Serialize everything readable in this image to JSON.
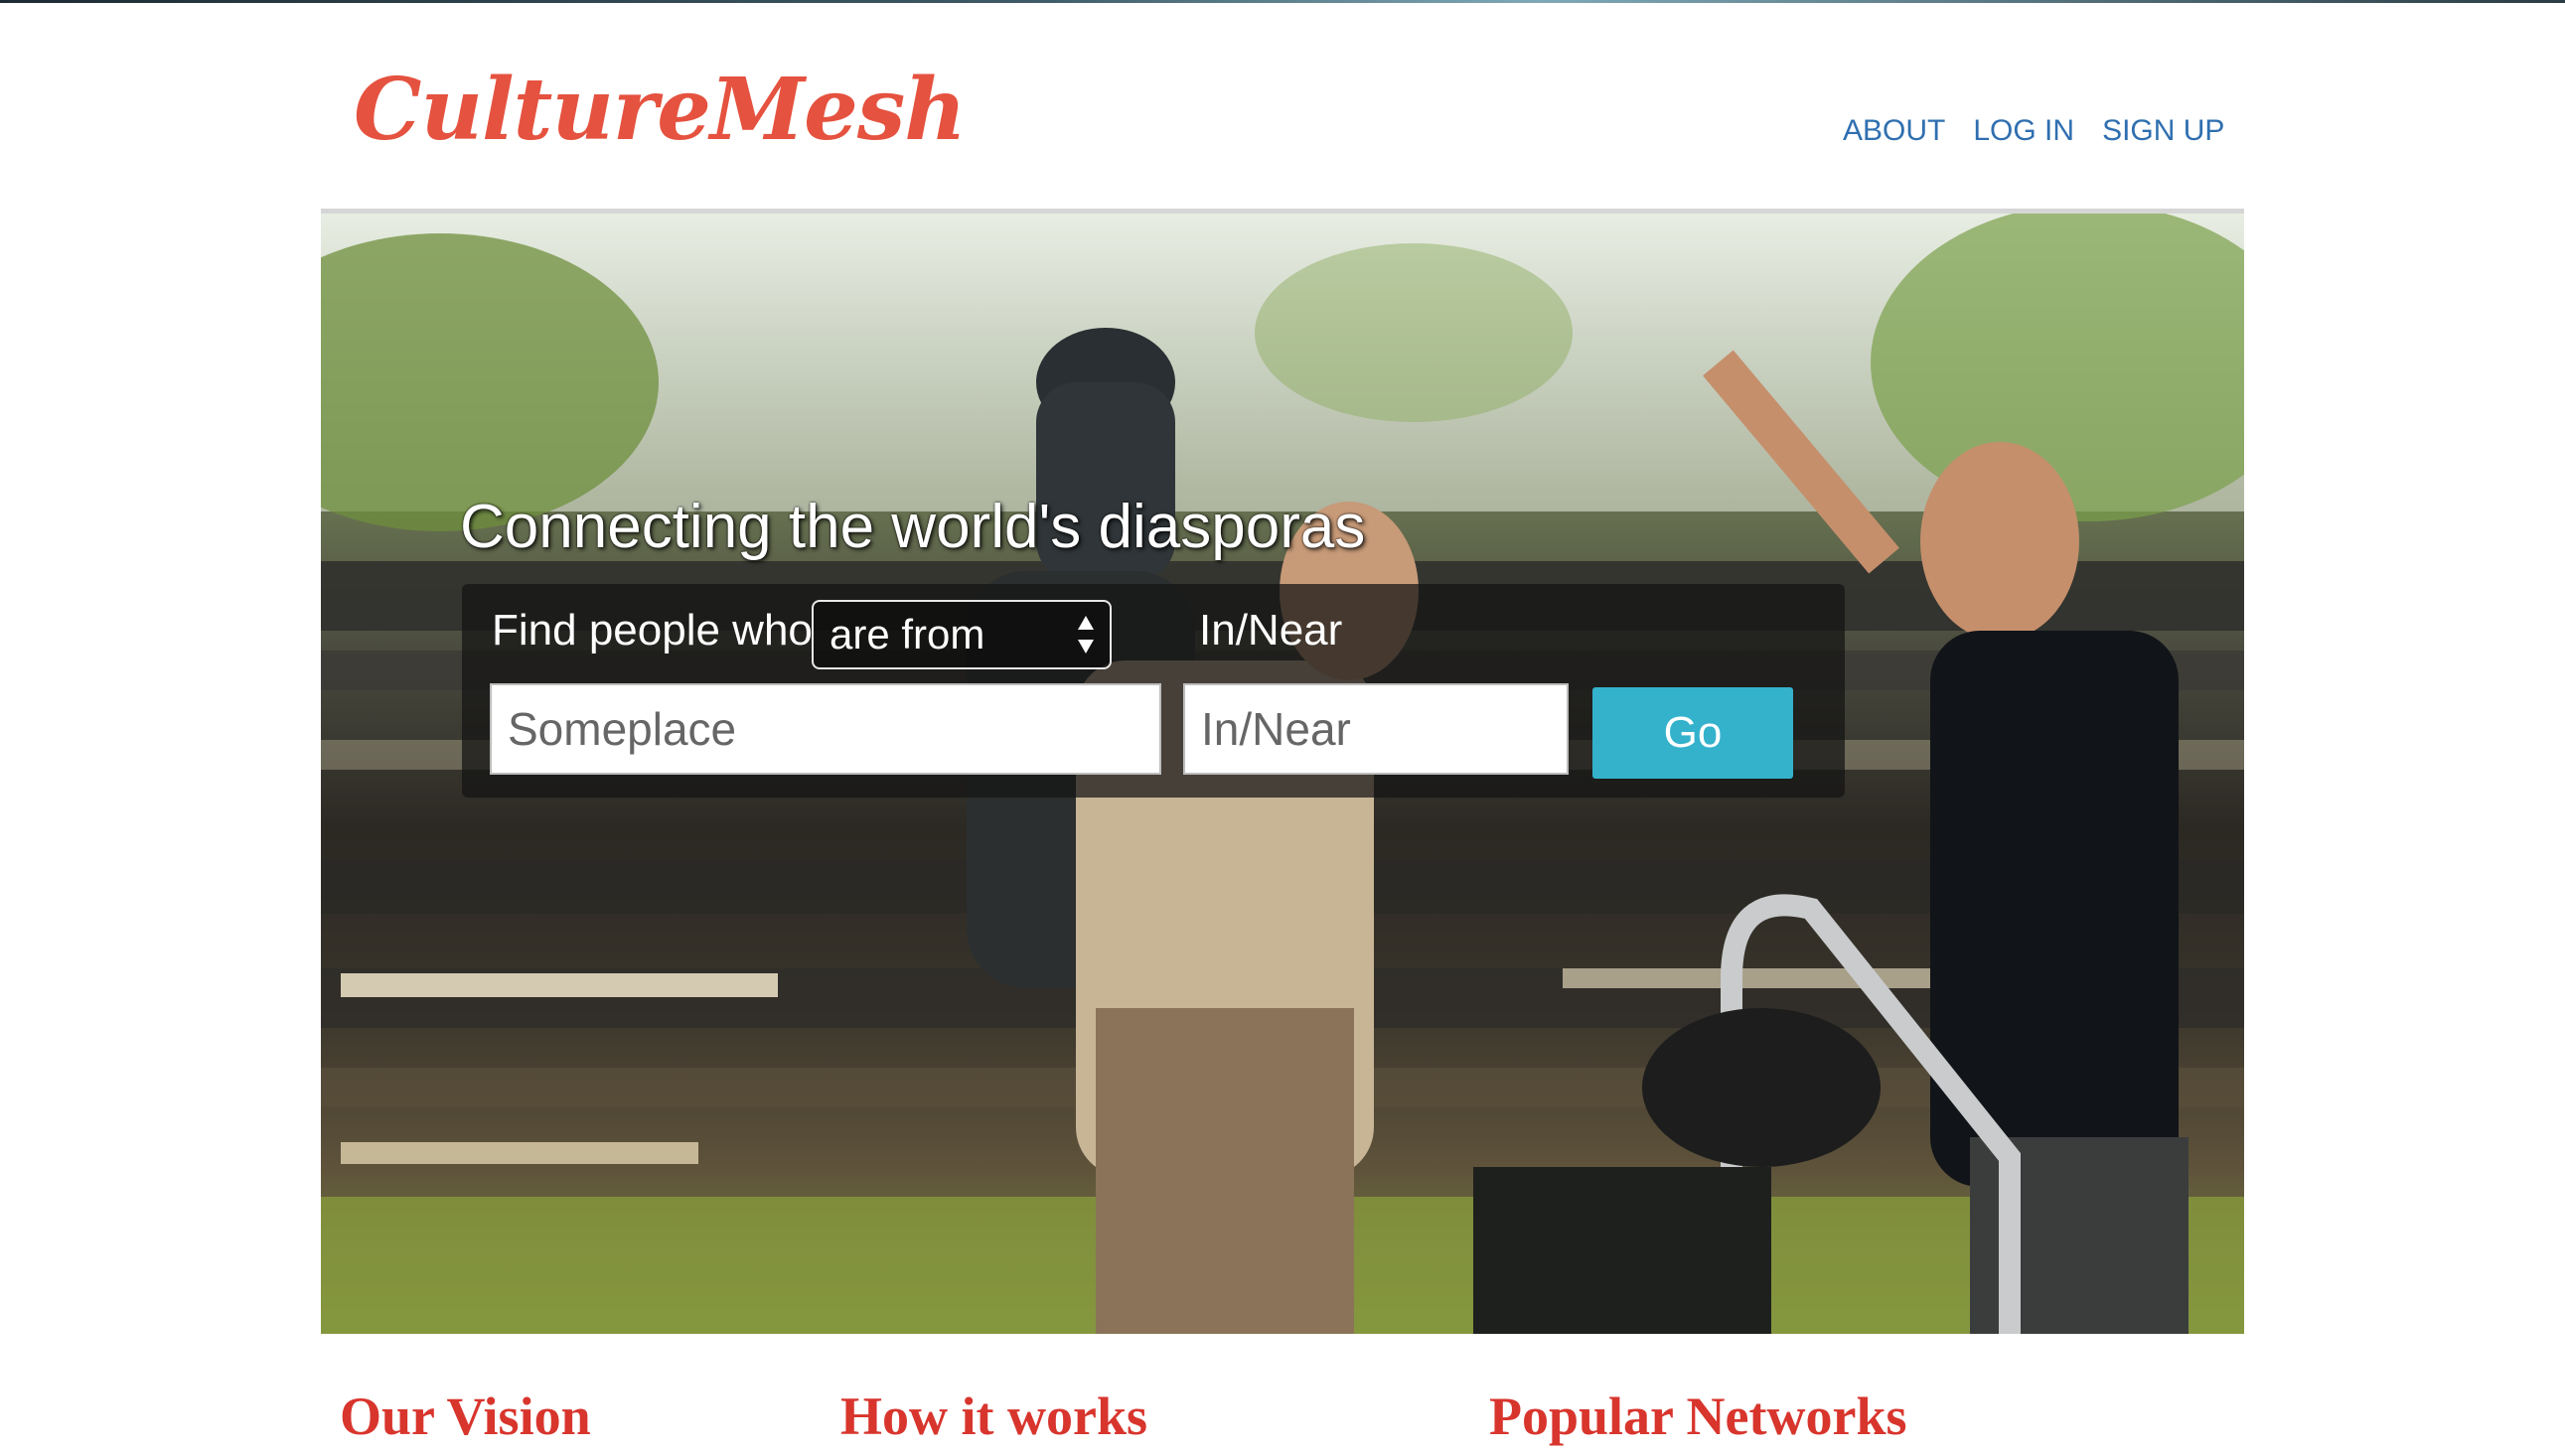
{
  "header": {
    "brand": "CultureMesh",
    "nav": [
      {
        "label": "ABOUT"
      },
      {
        "label": "LOG IN"
      },
      {
        "label": "SIGN UP"
      }
    ]
  },
  "hero": {
    "tagline": "Connecting the world's diasporas",
    "search": {
      "find_label": "Find people who",
      "relation_selected": "are from",
      "in_near_label": "In/Near",
      "someplace_placeholder": "Someplace",
      "in_near_placeholder": "In/Near",
      "go_label": "Go"
    }
  },
  "sections": [
    {
      "heading": "Our Vision"
    },
    {
      "heading": "How it works"
    },
    {
      "heading": "Popular Networks"
    }
  ],
  "colors": {
    "brand_red": "#e5523f",
    "nav_blue": "#2f6fb0",
    "go_button": "#34b2cc",
    "heading_red": "#d8352d",
    "globe_green": "#7cc142"
  }
}
